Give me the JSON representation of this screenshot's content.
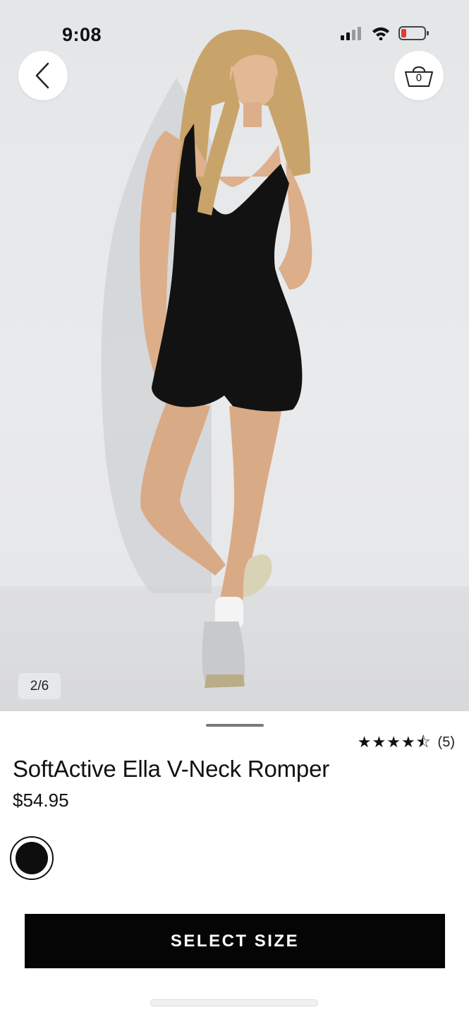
{
  "status_bar": {
    "time": "9:08",
    "icons": [
      "cellular-signal-icon",
      "wifi-icon",
      "battery-low-icon"
    ]
  },
  "nav": {
    "back_icon": "chevron-left-icon",
    "cart_icon": "shopping-basket-icon",
    "cart_count": "0"
  },
  "gallery": {
    "page_indicator": "2/6"
  },
  "product": {
    "title": "SoftActive Ella V-Neck Romper",
    "price": "$54.95",
    "rating": 4.5,
    "stars": [
      "★",
      "★",
      "★",
      "★",
      "⯪"
    ],
    "review_count": "(5)",
    "colors": [
      {
        "name": "black",
        "hex": "#0e0e0e",
        "selected": true
      }
    ]
  },
  "actions": {
    "select_size_label": "SELECT SIZE"
  }
}
